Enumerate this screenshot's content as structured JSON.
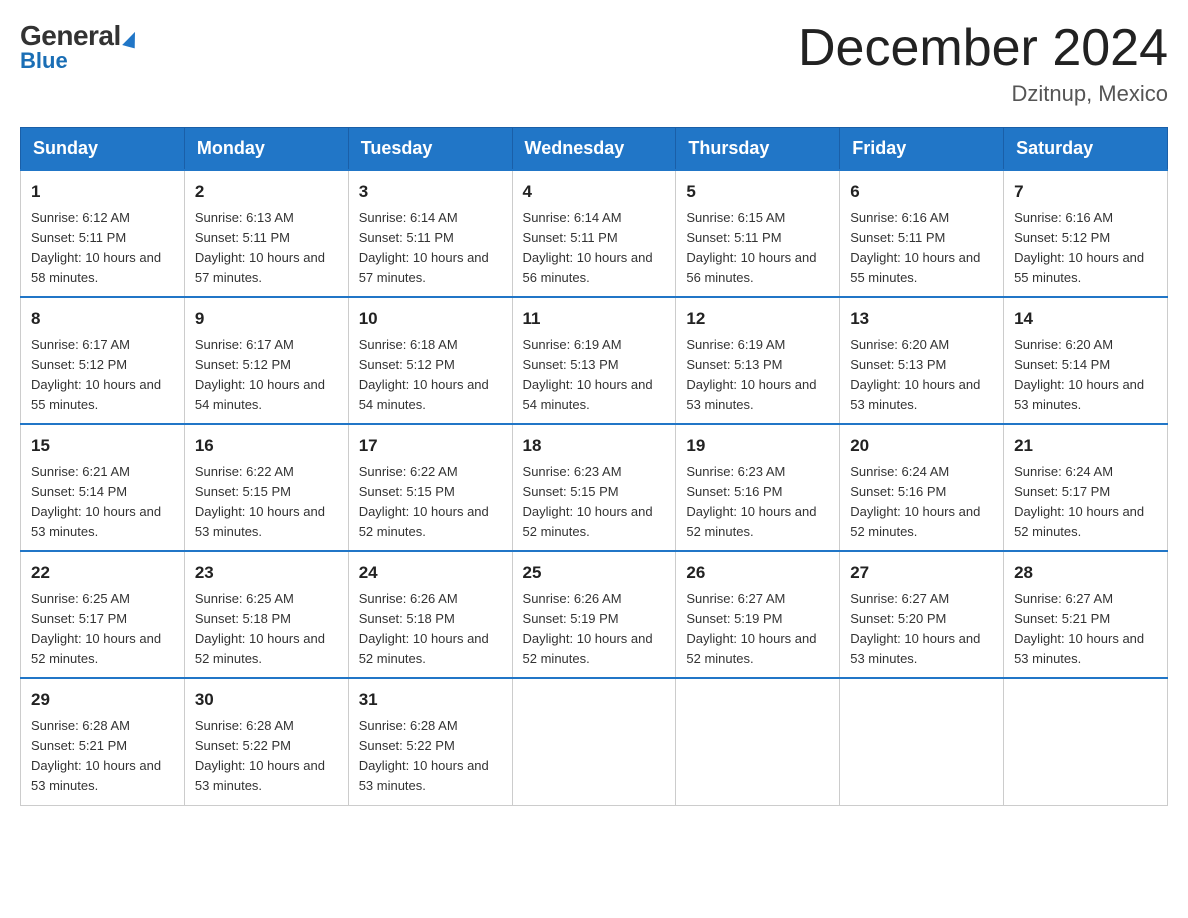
{
  "logo": {
    "top": "General",
    "arrow": "▶",
    "bottom": "Blue"
  },
  "title": "December 2024",
  "location": "Dzitnup, Mexico",
  "days_header": [
    "Sunday",
    "Monday",
    "Tuesday",
    "Wednesday",
    "Thursday",
    "Friday",
    "Saturday"
  ],
  "weeks": [
    [
      {
        "day": "1",
        "sunrise": "6:12 AM",
        "sunset": "5:11 PM",
        "daylight": "10 hours and 58 minutes."
      },
      {
        "day": "2",
        "sunrise": "6:13 AM",
        "sunset": "5:11 PM",
        "daylight": "10 hours and 57 minutes."
      },
      {
        "day": "3",
        "sunrise": "6:14 AM",
        "sunset": "5:11 PM",
        "daylight": "10 hours and 57 minutes."
      },
      {
        "day": "4",
        "sunrise": "6:14 AM",
        "sunset": "5:11 PM",
        "daylight": "10 hours and 56 minutes."
      },
      {
        "day": "5",
        "sunrise": "6:15 AM",
        "sunset": "5:11 PM",
        "daylight": "10 hours and 56 minutes."
      },
      {
        "day": "6",
        "sunrise": "6:16 AM",
        "sunset": "5:11 PM",
        "daylight": "10 hours and 55 minutes."
      },
      {
        "day": "7",
        "sunrise": "6:16 AM",
        "sunset": "5:12 PM",
        "daylight": "10 hours and 55 minutes."
      }
    ],
    [
      {
        "day": "8",
        "sunrise": "6:17 AM",
        "sunset": "5:12 PM",
        "daylight": "10 hours and 55 minutes."
      },
      {
        "day": "9",
        "sunrise": "6:17 AM",
        "sunset": "5:12 PM",
        "daylight": "10 hours and 54 minutes."
      },
      {
        "day": "10",
        "sunrise": "6:18 AM",
        "sunset": "5:12 PM",
        "daylight": "10 hours and 54 minutes."
      },
      {
        "day": "11",
        "sunrise": "6:19 AM",
        "sunset": "5:13 PM",
        "daylight": "10 hours and 54 minutes."
      },
      {
        "day": "12",
        "sunrise": "6:19 AM",
        "sunset": "5:13 PM",
        "daylight": "10 hours and 53 minutes."
      },
      {
        "day": "13",
        "sunrise": "6:20 AM",
        "sunset": "5:13 PM",
        "daylight": "10 hours and 53 minutes."
      },
      {
        "day": "14",
        "sunrise": "6:20 AM",
        "sunset": "5:14 PM",
        "daylight": "10 hours and 53 minutes."
      }
    ],
    [
      {
        "day": "15",
        "sunrise": "6:21 AM",
        "sunset": "5:14 PM",
        "daylight": "10 hours and 53 minutes."
      },
      {
        "day": "16",
        "sunrise": "6:22 AM",
        "sunset": "5:15 PM",
        "daylight": "10 hours and 53 minutes."
      },
      {
        "day": "17",
        "sunrise": "6:22 AM",
        "sunset": "5:15 PM",
        "daylight": "10 hours and 52 minutes."
      },
      {
        "day": "18",
        "sunrise": "6:23 AM",
        "sunset": "5:15 PM",
        "daylight": "10 hours and 52 minutes."
      },
      {
        "day": "19",
        "sunrise": "6:23 AM",
        "sunset": "5:16 PM",
        "daylight": "10 hours and 52 minutes."
      },
      {
        "day": "20",
        "sunrise": "6:24 AM",
        "sunset": "5:16 PM",
        "daylight": "10 hours and 52 minutes."
      },
      {
        "day": "21",
        "sunrise": "6:24 AM",
        "sunset": "5:17 PM",
        "daylight": "10 hours and 52 minutes."
      }
    ],
    [
      {
        "day": "22",
        "sunrise": "6:25 AM",
        "sunset": "5:17 PM",
        "daylight": "10 hours and 52 minutes."
      },
      {
        "day": "23",
        "sunrise": "6:25 AM",
        "sunset": "5:18 PM",
        "daylight": "10 hours and 52 minutes."
      },
      {
        "day": "24",
        "sunrise": "6:26 AM",
        "sunset": "5:18 PM",
        "daylight": "10 hours and 52 minutes."
      },
      {
        "day": "25",
        "sunrise": "6:26 AM",
        "sunset": "5:19 PM",
        "daylight": "10 hours and 52 minutes."
      },
      {
        "day": "26",
        "sunrise": "6:27 AM",
        "sunset": "5:19 PM",
        "daylight": "10 hours and 52 minutes."
      },
      {
        "day": "27",
        "sunrise": "6:27 AM",
        "sunset": "5:20 PM",
        "daylight": "10 hours and 53 minutes."
      },
      {
        "day": "28",
        "sunrise": "6:27 AM",
        "sunset": "5:21 PM",
        "daylight": "10 hours and 53 minutes."
      }
    ],
    [
      {
        "day": "29",
        "sunrise": "6:28 AM",
        "sunset": "5:21 PM",
        "daylight": "10 hours and 53 minutes."
      },
      {
        "day": "30",
        "sunrise": "6:28 AM",
        "sunset": "5:22 PM",
        "daylight": "10 hours and 53 minutes."
      },
      {
        "day": "31",
        "sunrise": "6:28 AM",
        "sunset": "5:22 PM",
        "daylight": "10 hours and 53 minutes."
      },
      null,
      null,
      null,
      null
    ]
  ]
}
